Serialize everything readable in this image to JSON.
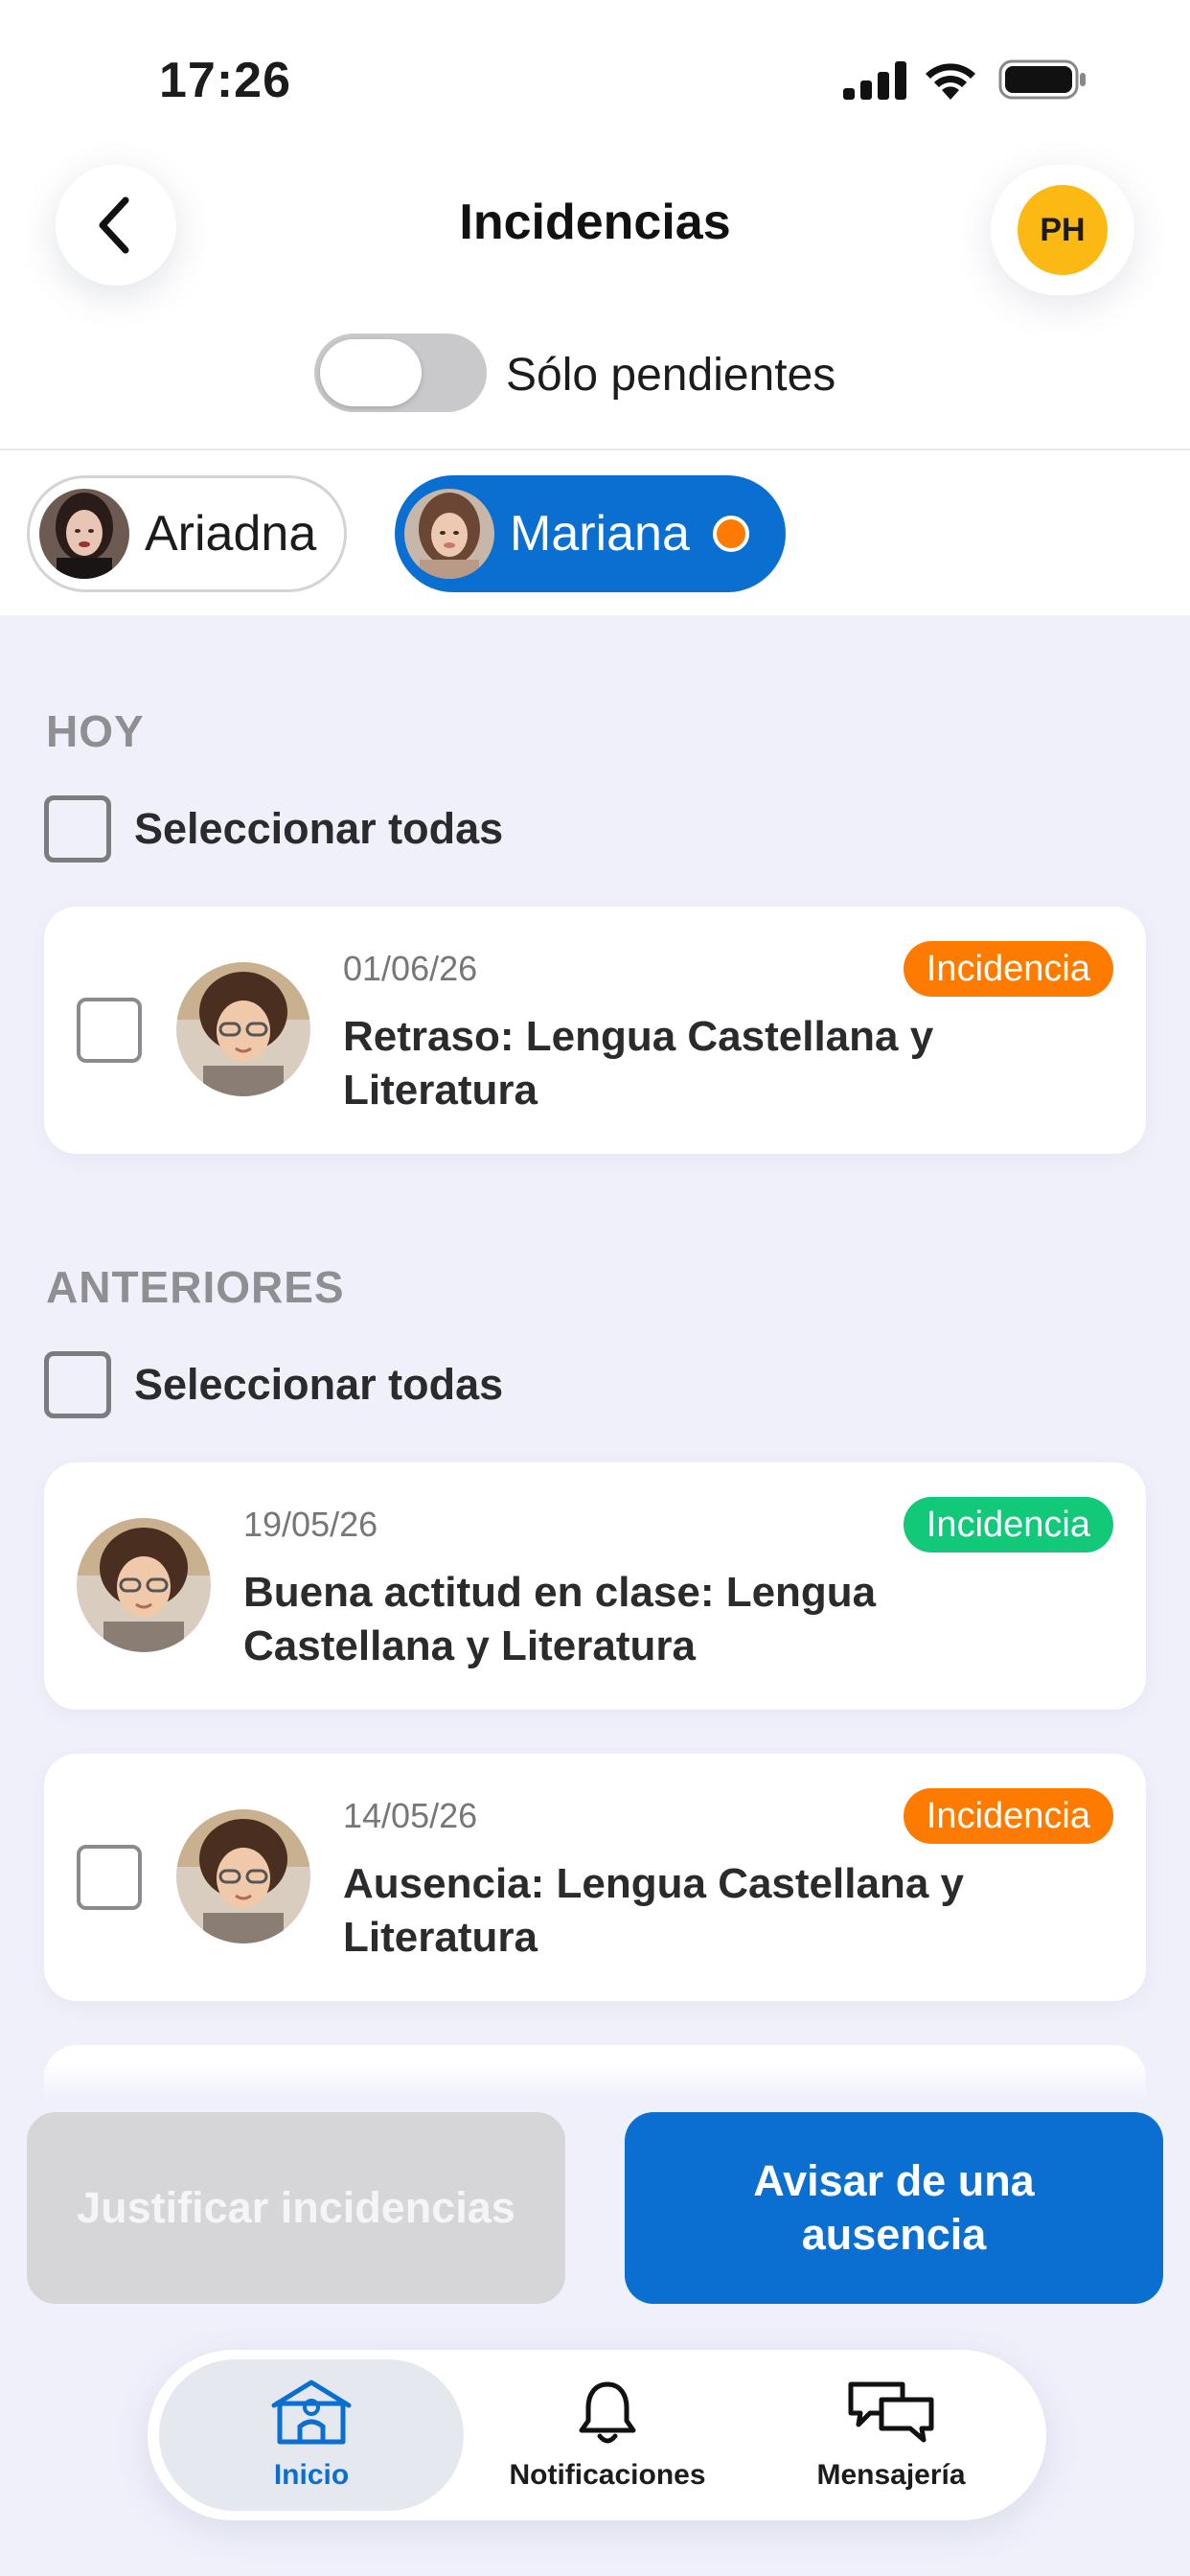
{
  "status_bar": {
    "time": "17:26"
  },
  "header": {
    "title": "Incidencias",
    "avatar_initials": "PH"
  },
  "filter": {
    "toggle_label": "Sólo pendientes",
    "toggle_on": false
  },
  "students": [
    {
      "name": "Ariadna",
      "selected": false,
      "has_alert": false
    },
    {
      "name": "Mariana",
      "selected": true,
      "has_alert": true
    }
  ],
  "sections": {
    "today": {
      "heading": "HOY",
      "select_all": "Seleccionar todas",
      "items": [
        {
          "date": "01/06/26",
          "title": "Retraso: Lengua Castellana y Literatura",
          "badge": "Incidencia",
          "badge_color": "#ff7b00",
          "selectable": true
        }
      ]
    },
    "previous": {
      "heading": "ANTERIORES",
      "select_all": "Seleccionar todas",
      "items": [
        {
          "date": "19/05/26",
          "title": "Buena actitud en clase: Lengua Castellana y Literatura",
          "badge": "Incidencia",
          "badge_color": "#12c97a",
          "selectable": false
        },
        {
          "date": "14/05/26",
          "title": "Ausencia: Lengua Castellana y Literatura",
          "badge": "Incidencia",
          "badge_color": "#ff7b00",
          "selectable": true
        }
      ]
    }
  },
  "actions": {
    "justify_label": "Justificar incidencias",
    "justify_enabled": false,
    "notify_absence_label": "Avisar de una ausencia"
  },
  "tabbar": {
    "items": [
      {
        "label": "Inicio",
        "icon": "school-home-icon",
        "active": true
      },
      {
        "label": "Notificaciones",
        "icon": "bell-icon",
        "active": false
      },
      {
        "label": "Mensajería",
        "icon": "chat-bubbles-icon",
        "active": false
      }
    ]
  },
  "colors": {
    "primary": "#0a6fd1",
    "avatar": "#fdb913",
    "alert": "#ff7a00",
    "badge_orange": "#ff7b00",
    "badge_green": "#12c97a"
  }
}
